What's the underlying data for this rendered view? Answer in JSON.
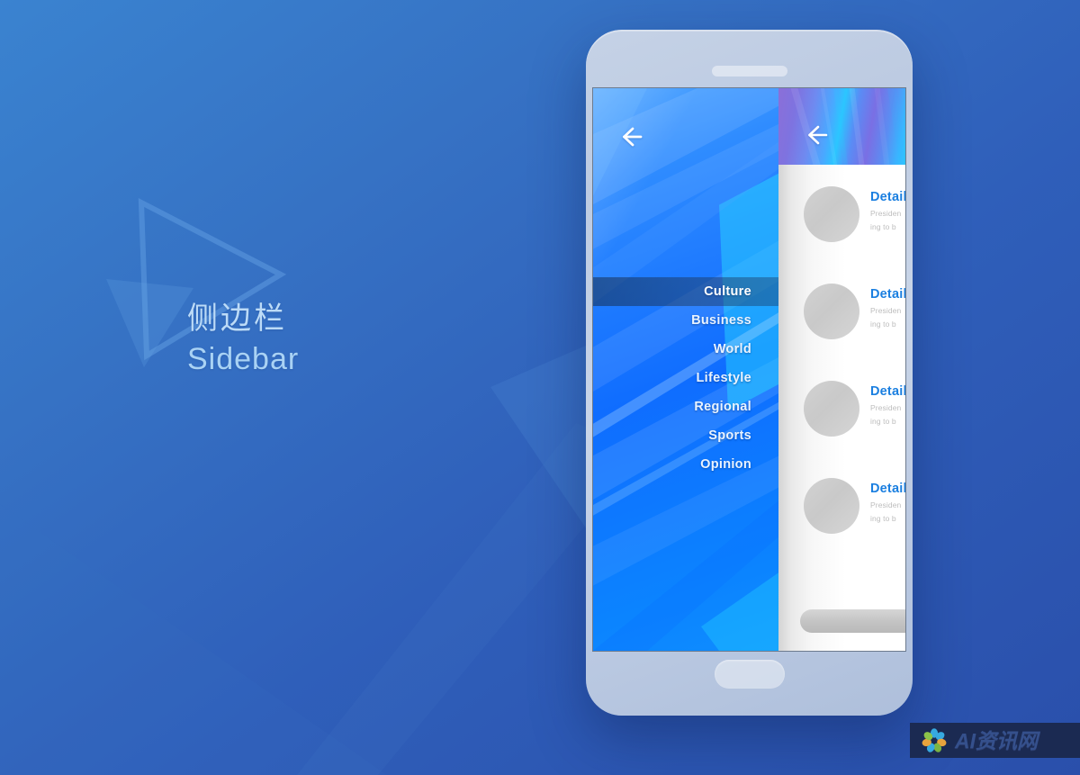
{
  "page": {
    "title_cn": "侧边栏",
    "title_en": "Sidebar",
    "background_top_color": "#3a83d0",
    "background_bottom_color": "#2a4fab",
    "caption_color": "#b6d7f5"
  },
  "phone": {
    "speaker_label": "earpiece-speaker",
    "home_button_label": "home-button"
  },
  "drawer": {
    "back_icon": "arrow-left-icon",
    "accent_color": "#0f6dff",
    "active_item": "Culture",
    "items": [
      {
        "label": "Culture",
        "active": true
      },
      {
        "label": "Business",
        "active": false
      },
      {
        "label": "World",
        "active": false
      },
      {
        "label": "Lifestyle",
        "active": false
      },
      {
        "label": "Regional",
        "active": false
      },
      {
        "label": "Sports",
        "active": false
      },
      {
        "label": "Opinion",
        "active": false
      }
    ]
  },
  "content": {
    "back_icon": "arrow-left-icon",
    "header_gradient_start": "#8b6fd8",
    "header_gradient_end": "#2ccbff",
    "title_color": "#1b7fe0",
    "items": [
      {
        "title": "Detail",
        "desc_line1": "Presiden",
        "desc_line2": "ing to b"
      },
      {
        "title": "Detail",
        "desc_line1": "Presiden",
        "desc_line2": "ing to b"
      },
      {
        "title": "Detail",
        "desc_line1": "Presiden",
        "desc_line2": "ing to b"
      },
      {
        "title": "Detail",
        "desc_line1": "Presiden",
        "desc_line2": "ing to b"
      }
    ],
    "footer_bar_label": "bottom-action-bar"
  },
  "watermark": {
    "text": "AI资讯网",
    "logo_name": "flower-logo-icon",
    "background_color": "#1b2a52",
    "text_color": "#35508c"
  }
}
